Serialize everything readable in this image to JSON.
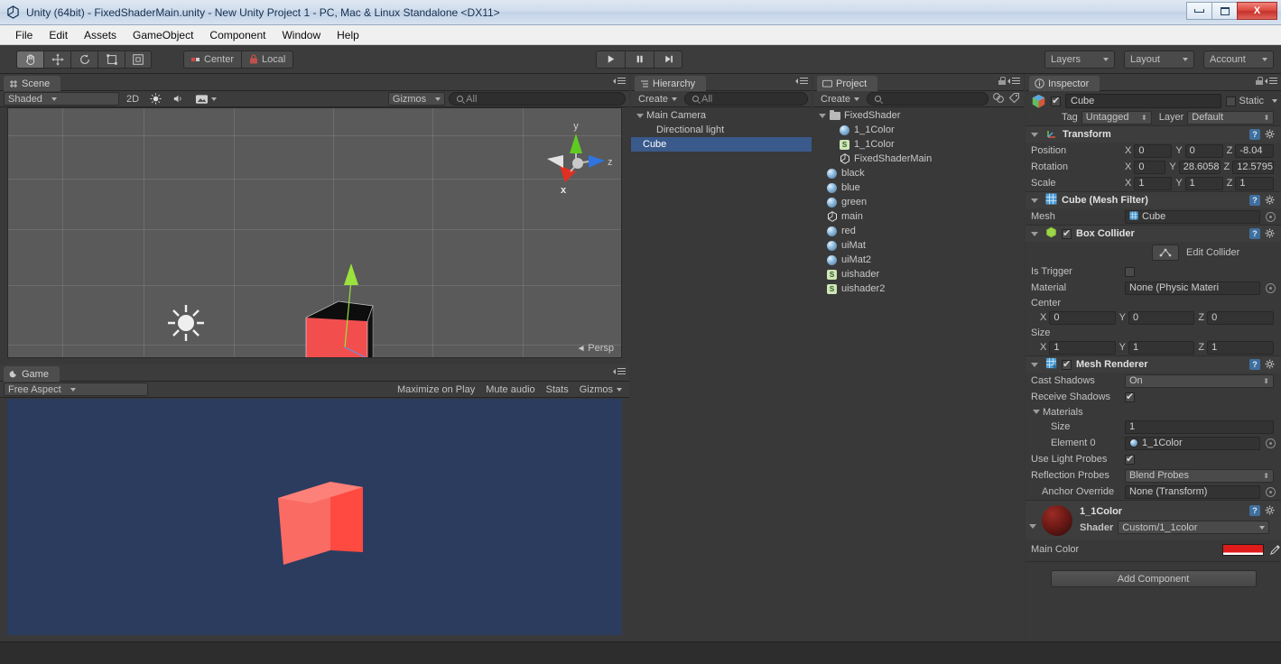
{
  "window": {
    "title": "Unity (64bit) - FixedShaderMain.unity - New Unity Project 1 - PC, Mac & Linux Standalone <DX11>",
    "minimize_label": "Minimize",
    "maximize_label": "Maximize",
    "close_label": "X"
  },
  "menu": [
    "File",
    "Edit",
    "Assets",
    "GameObject",
    "Component",
    "Window",
    "Help"
  ],
  "toolbar": {
    "tools": [
      "hand-tool",
      "move-tool",
      "rotate-tool",
      "scale-tool",
      "rect-tool"
    ],
    "pivot": "Center",
    "space": "Local",
    "play": "Play",
    "pause": "Pause",
    "step": "Step",
    "layers": "Layers",
    "layout": "Layout",
    "account": "Account"
  },
  "scene": {
    "tab": "Scene",
    "shading": "Shaded",
    "mode_2d": "2D",
    "gizmos": "Gizmos",
    "search_placeholder": "All",
    "axis_y": "y",
    "axis_x": "x",
    "axis_z": "z",
    "projection": "Persp",
    "bg_color": "#5a5a5a",
    "cube_color": "#ff4d4d"
  },
  "game": {
    "tab": "Game",
    "aspect": "Free Aspect",
    "maximize_on_play": "Maximize on Play",
    "mute_audio": "Mute audio",
    "stats": "Stats",
    "gizmos": "Gizmos",
    "bg_color": "#2b3c5e",
    "cube_color": "#fa564f"
  },
  "hierarchy": {
    "tab": "Hierarchy",
    "create": "Create",
    "search_placeholder": "All",
    "items": [
      {
        "label": "Main Camera",
        "indent": 0,
        "expandable": true,
        "selected": false
      },
      {
        "label": "Directional light",
        "indent": 1,
        "expandable": false,
        "selected": false
      },
      {
        "label": "Cube",
        "indent": 0,
        "expandable": false,
        "selected": true
      }
    ]
  },
  "project": {
    "tab": "Project",
    "create": "Create",
    "search_placeholder": "",
    "items": [
      {
        "label": "FixedShader",
        "icon": "folder-icon",
        "indent": 0,
        "expandable": true
      },
      {
        "label": "1_1Color",
        "icon": "material-icon",
        "indent": 1,
        "expandable": false
      },
      {
        "label": "1_1Color",
        "icon": "shader-icon",
        "indent": 1,
        "expandable": false
      },
      {
        "label": "FixedShaderMain",
        "icon": "unity-scene-icon",
        "indent": 1,
        "expandable": false
      },
      {
        "label": "black",
        "icon": "material-icon",
        "indent": 0,
        "expandable": false
      },
      {
        "label": "blue",
        "icon": "material-icon",
        "indent": 0,
        "expandable": false
      },
      {
        "label": "green",
        "icon": "material-icon",
        "indent": 0,
        "expandable": false
      },
      {
        "label": "main",
        "icon": "unity-scene-icon",
        "indent": 0,
        "expandable": false
      },
      {
        "label": "red",
        "icon": "material-icon",
        "indent": 0,
        "expandable": false
      },
      {
        "label": "uiMat",
        "icon": "material-icon",
        "indent": 0,
        "expandable": false
      },
      {
        "label": "uiMat2",
        "icon": "material-icon",
        "indent": 0,
        "expandable": false
      },
      {
        "label": "uishader",
        "icon": "shader-icon",
        "indent": 0,
        "expandable": false
      },
      {
        "label": "uishader2",
        "icon": "shader-icon",
        "indent": 0,
        "expandable": false
      }
    ]
  },
  "inspector": {
    "tab": "Inspector",
    "object_name": "Cube",
    "object_enabled": true,
    "static_label": "Static",
    "tag_label": "Tag",
    "tag_value": "Untagged",
    "layer_label": "Layer",
    "layer_value": "Default",
    "transform": {
      "title": "Transform",
      "position_label": "Position",
      "position": {
        "x": "0",
        "y": "0",
        "z": "-8.04"
      },
      "rotation_label": "Rotation",
      "rotation": {
        "x": "0",
        "y": "28.6058",
        "z": "12.5795"
      },
      "scale_label": "Scale",
      "scale": {
        "x": "1",
        "y": "1",
        "z": "1"
      }
    },
    "mesh_filter": {
      "title": "Cube (Mesh Filter)",
      "mesh_label": "Mesh",
      "mesh_value": "Cube"
    },
    "box_collider": {
      "title": "Box Collider",
      "enabled": true,
      "edit_collider": "Edit Collider",
      "is_trigger_label": "Is Trigger",
      "is_trigger": false,
      "material_label": "Material",
      "material_value": "None (Physic Materi",
      "center_label": "Center",
      "center": {
        "x": "0",
        "y": "0",
        "z": "0"
      },
      "size_label": "Size",
      "size": {
        "x": "1",
        "y": "1",
        "z": "1"
      }
    },
    "mesh_renderer": {
      "title": "Mesh Renderer",
      "enabled": true,
      "cast_shadows_label": "Cast Shadows",
      "cast_shadows": "On",
      "receive_shadows_label": "Receive Shadows",
      "receive_shadows": true,
      "materials_label": "Materials",
      "size_label": "Size",
      "size_value": "1",
      "element0_label": "Element 0",
      "element0_value": "1_1Color",
      "use_light_probes_label": "Use Light Probes",
      "use_light_probes": true,
      "reflection_probes_label": "Reflection Probes",
      "reflection_probes": "Blend Probes",
      "anchor_override_label": "Anchor Override",
      "anchor_override": "None (Transform)"
    },
    "material": {
      "name": "1_1Color",
      "shader_label": "Shader",
      "shader_value": "Custom/1_1color",
      "main_color_label": "Main Color",
      "main_color": "#e01b1b"
    },
    "add_component": "Add Component"
  }
}
